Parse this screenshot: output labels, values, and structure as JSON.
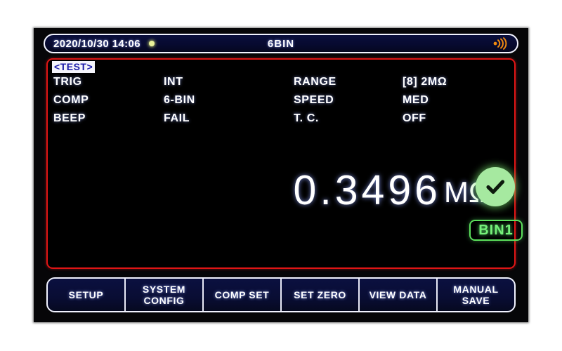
{
  "status_bar": {
    "datetime": "2020/10/30  14:06",
    "indicator_dot": "status-dot",
    "mode_label": "6BIN",
    "signal_icon": "signal-broadcast-icon"
  },
  "screen": {
    "mode_tag": "<TEST>",
    "parameters": [
      {
        "label": "TRIG",
        "value": "INT",
        "label2": "RANGE",
        "value2": "[8] 2MΩ"
      },
      {
        "label": "COMP",
        "value": "6-BIN",
        "label2": "SPEED",
        "value2": "MED"
      },
      {
        "label": "BEEP",
        "value": "FAIL",
        "label2": "T. C.",
        "value2": "OFF"
      }
    ],
    "reading": {
      "value": "0.3496",
      "unit": "MΩ"
    },
    "result": {
      "pass_icon": "check-circle-icon",
      "bin_label": "BIN1"
    }
  },
  "function_bar": {
    "buttons": [
      {
        "label": "SETUP"
      },
      {
        "label": "SYSTEM\nCONFIG"
      },
      {
        "label": "COMP SET"
      },
      {
        "label": "SET ZERO"
      },
      {
        "label": "VIEW DATA"
      },
      {
        "label": "MANUAL\nSAVE"
      }
    ]
  },
  "colors": {
    "frame_red": "#e01515",
    "pass_green": "#a6e9a0",
    "bin_green": "#5ce05c",
    "signal_orange": "#f08a10",
    "panel_black": "#060608",
    "bar_navy": "#0a0f3c"
  }
}
